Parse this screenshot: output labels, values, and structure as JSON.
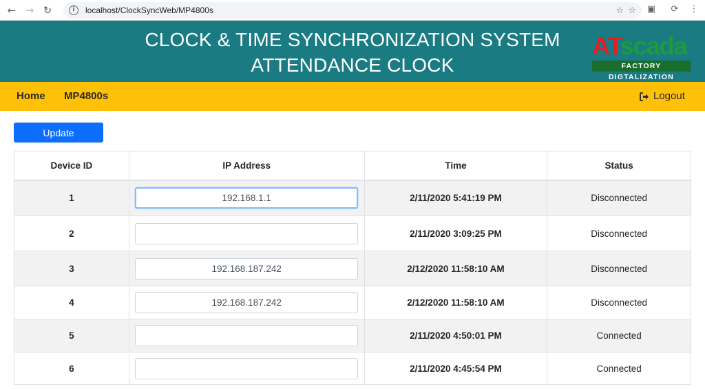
{
  "browser": {
    "url": "localhost/ClockSyncWeb/MP4800s"
  },
  "header": {
    "title_line1": "CLOCK & TIME SYNCHRONIZATION SYSTEM",
    "title_line2": "ATTENDANCE CLOCK",
    "logo_at": "AT",
    "logo_scada": "scada",
    "logo_tagline": "FACTORY DIGTALIZATION",
    "background_color": "#1b7b83"
  },
  "nav": {
    "home": "Home",
    "mp": "MP4800s",
    "logout": "Logout",
    "background_color": "#ffc107"
  },
  "actions": {
    "update_label": "Update",
    "accent_color": "#0d6efd"
  },
  "table": {
    "headers": [
      "Device ID",
      "IP Address",
      "Time",
      "Status"
    ],
    "rows": [
      {
        "id": "1",
        "ip": "192.168.1.1",
        "time": "2/11/2020 5:41:19 PM",
        "status": "Disconnected"
      },
      {
        "id": "2",
        "ip": "",
        "time": "2/11/2020 3:09:25 PM",
        "status": "Disconnected"
      },
      {
        "id": "3",
        "ip": "192.168.187.242",
        "time": "2/12/2020 11:58:10 AM",
        "status": "Disconnected"
      },
      {
        "id": "4",
        "ip": "192.168.187.242",
        "time": "2/12/2020 11:58:10 AM",
        "status": "Disconnected"
      },
      {
        "id": "5",
        "ip": "",
        "time": "2/11/2020 4:50:01 PM",
        "status": "Connected"
      },
      {
        "id": "6",
        "ip": "",
        "time": "2/11/2020 4:45:54 PM",
        "status": "Connected"
      }
    ]
  }
}
